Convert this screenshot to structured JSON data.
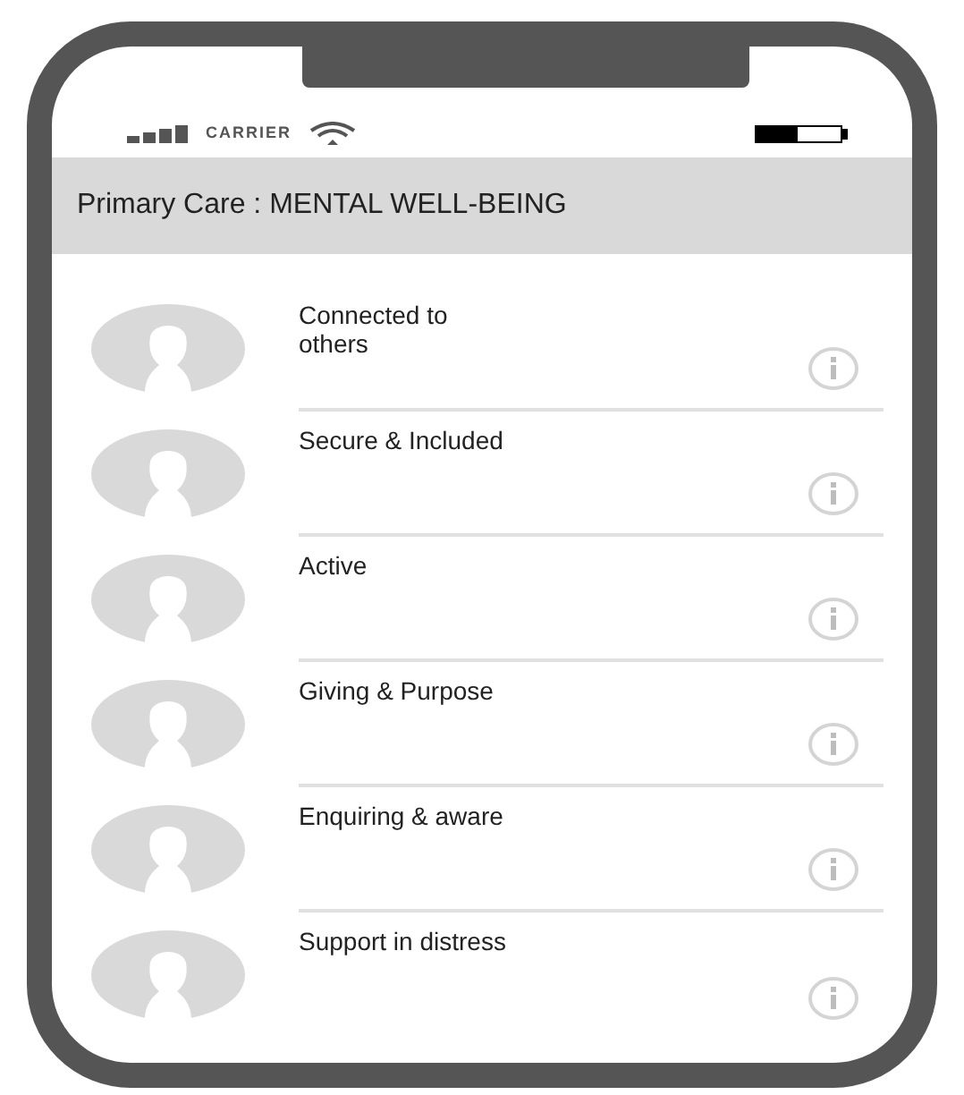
{
  "status_bar": {
    "carrier": "CARRIER"
  },
  "header": {
    "title": "Primary Care : MENTAL WELL-BEING"
  },
  "items": [
    {
      "label": "Connected to\nothers"
    },
    {
      "label": "Secure & Included"
    },
    {
      "label": "Active"
    },
    {
      "label": "Giving & Purpose"
    },
    {
      "label": "Enquiring & aware"
    },
    {
      "label": "Support in distress"
    }
  ]
}
